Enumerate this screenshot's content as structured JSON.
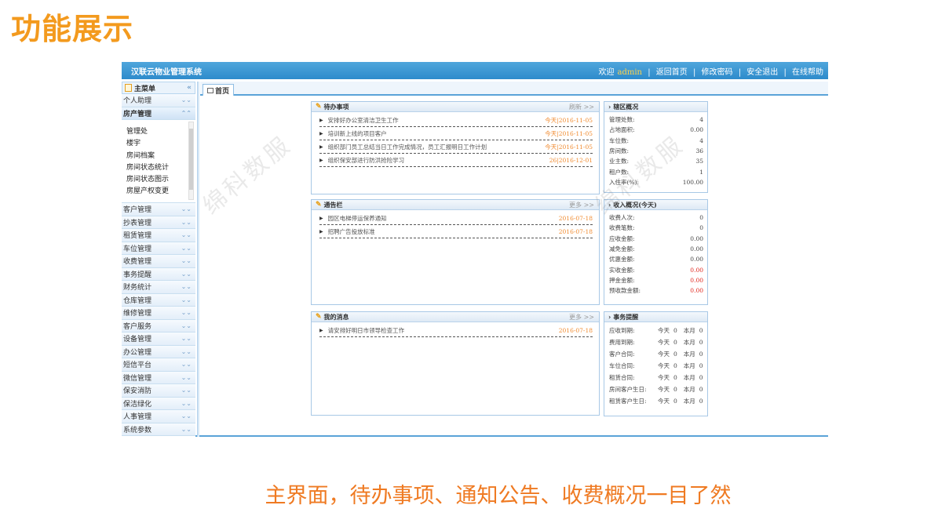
{
  "slide_title": "功能展示",
  "caption": "主界面，待办事项、通知公告、收费概况一目了然",
  "watermark": "绵科数服",
  "colors": {
    "accent_orange": "#f39a1e",
    "topbar_blue": "#2e8bcb",
    "date_orange": "#f08a2e",
    "alert_red": "#e0271e"
  },
  "topbar": {
    "system_name": "汉联云物业管理系统",
    "welcome": "欢迎",
    "user": "admin",
    "links": [
      "返回首页",
      "修改密码",
      "安全退出",
      "在线帮助"
    ],
    "separator": "|"
  },
  "sidebar": {
    "header": "主菜单",
    "collapse_glyph": "«",
    "items_before": [
      {
        "label": "个人助理",
        "state": "collapsed"
      },
      {
        "label": "房产管理",
        "state": "expanded"
      }
    ],
    "submenu": [
      "管理处",
      "楼宇",
      "房间档案",
      "房间状态统计",
      "房间状态图示",
      "房屋产权变更"
    ],
    "items_after": [
      "客户管理",
      "抄表管理",
      "租赁管理",
      "车位管理",
      "收费管理",
      "事务提醒",
      "财务统计",
      "仓库管理",
      "维修管理",
      "客户服务",
      "设备管理",
      "办公管理",
      "短信平台",
      "微信管理",
      "保安消防",
      "保洁绿化",
      "人事管理",
      "系统参数"
    ]
  },
  "tab": {
    "label": "首页"
  },
  "todo": {
    "title": "待办事项",
    "action": "刷新 >>",
    "items": [
      {
        "text": "安排好办公室清洁卫生工作",
        "date": "今天|2016-11-05"
      },
      {
        "text": "培训新上线的项目客户",
        "date": "今天|2016-11-05"
      },
      {
        "text": "组织部门员工总结当日工作完成情况，员工汇报明日工作计划",
        "date": "今天|2016-11-05"
      },
      {
        "text": "组织保安部进行防洪抢险学习",
        "date": "26|2016-12-01"
      }
    ]
  },
  "notice": {
    "title": "通告栏",
    "action": "更多 >>",
    "items": [
      {
        "text": "园区电梯停运保养通知",
        "date": "2016-07-18"
      },
      {
        "text": "招聘广告投放标准",
        "date": "2016-07-18"
      }
    ]
  },
  "messages": {
    "title": "我的消息",
    "action": "更多 >>",
    "items": [
      {
        "text": "请安排好明日市领导检查工作",
        "date": "2016-07-18"
      }
    ]
  },
  "district": {
    "title": "辖区概况",
    "rows": [
      {
        "k": "管理处数:",
        "v": "4"
      },
      {
        "k": "占地面积:",
        "v": "0.00"
      },
      {
        "k": "车位数:",
        "v": "4"
      },
      {
        "k": "房间数:",
        "v": "36"
      },
      {
        "k": "业主数:",
        "v": "35"
      },
      {
        "k": "租户数:",
        "v": "1"
      },
      {
        "k": "入住率(%):",
        "v": "100.00"
      }
    ]
  },
  "income": {
    "title": "收入概况(今天)",
    "rows": [
      {
        "k": "收费人次:",
        "v": "0",
        "red": false
      },
      {
        "k": "收费笔数:",
        "v": "0",
        "red": false
      },
      {
        "k": "应收金额:",
        "v": "0.00",
        "red": false
      },
      {
        "k": "减免金额:",
        "v": "0.00",
        "red": false
      },
      {
        "k": "优惠金额:",
        "v": "0.00",
        "red": false
      },
      {
        "k": "实收金额:",
        "v": "0.00",
        "red": true
      },
      {
        "k": "押金金额:",
        "v": "0.00",
        "red": true
      },
      {
        "k": "预收款金额:",
        "v": "0.00",
        "red": true
      }
    ]
  },
  "reminders": {
    "title": "事务提醒",
    "today_label": "今天",
    "month_label": "本月",
    "rows": [
      {
        "k": "应收到期:",
        "today": "0",
        "month": "0"
      },
      {
        "k": "费用到期:",
        "today": "0",
        "month": "0"
      },
      {
        "k": "客户合同:",
        "today": "0",
        "month": "0"
      },
      {
        "k": "车位合同:",
        "today": "0",
        "month": "0"
      },
      {
        "k": "租赁合同:",
        "today": "0",
        "month": "0"
      },
      {
        "k": "房间客户生日:",
        "today": "0",
        "month": "0"
      },
      {
        "k": "租赁客户生日:",
        "today": "0",
        "month": "0"
      }
    ]
  }
}
